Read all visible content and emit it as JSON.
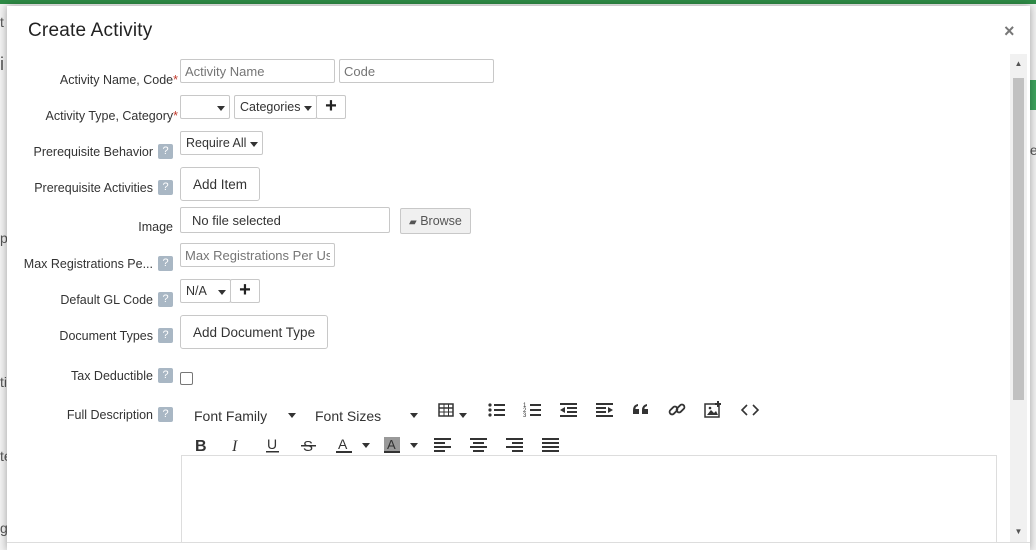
{
  "modal": {
    "title": "Create Activity",
    "close_glyph": "×"
  },
  "background": {
    "fragments": [
      "t",
      "i",
      "p",
      "ti",
      "te",
      "te",
      "g"
    ]
  },
  "form": {
    "activity_name": {
      "label": "Activity Name, Code",
      "required": "*",
      "name_placeholder": "Activity Name",
      "code_placeholder": "Code"
    },
    "activity_type": {
      "label": "Activity Type, Category",
      "required": "*",
      "type_value": "",
      "category_value": "Categories"
    },
    "prereq_behavior": {
      "label": "Prerequisite Behavior",
      "help": "?",
      "value": "Require All"
    },
    "prereq_activities": {
      "label": "Prerequisite Activities",
      "help": "?",
      "button": "Add Item"
    },
    "image": {
      "label": "Image",
      "file_text": "No file selected",
      "browse": "Browse"
    },
    "max_reg": {
      "label": "Max Registrations Pe...",
      "help": "?",
      "placeholder": "Max Registrations Per Use"
    },
    "gl_code": {
      "label": "Default GL Code",
      "help": "?",
      "value": "N/A"
    },
    "doc_types": {
      "label": "Document Types",
      "help": "?",
      "button": "Add Document Type"
    },
    "tax": {
      "label": "Tax Deductible",
      "help": "?"
    },
    "description": {
      "label": "Full Description",
      "help": "?",
      "font_family": "Font Family",
      "font_sizes": "Font Sizes",
      "icons_row1": [
        "table-icon",
        "bullet-list-icon",
        "numbered-list-icon",
        "outdent-icon",
        "indent-icon",
        "blockquote-icon",
        "link-icon",
        "image-icon",
        "code-icon"
      ],
      "icons_row2": [
        "bold-icon",
        "italic-icon",
        "underline-icon",
        "strikethrough-icon",
        "text-color-icon",
        "highlight-color-icon",
        "align-left-icon",
        "align-center-icon",
        "align-right-icon",
        "justify-icon"
      ]
    }
  },
  "colors": {
    "brand": "#2e8b46",
    "help": "#a9b7c4",
    "required": "#c0392b"
  }
}
